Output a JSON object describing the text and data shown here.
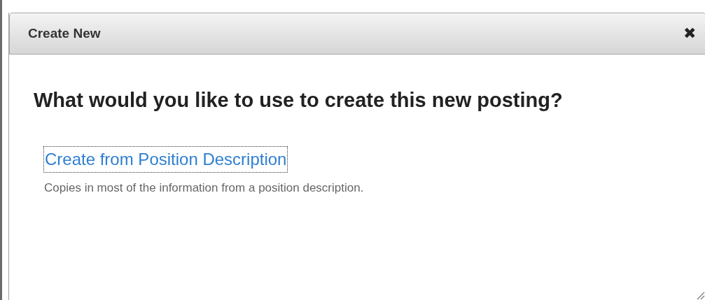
{
  "dialog": {
    "title": "Create New",
    "close": "✖",
    "heading": "What would you like to use to create this new posting?",
    "options": [
      {
        "label": "Create from Position Description",
        "focused": true,
        "description": "Copies in most of the information from a position description."
      }
    ]
  }
}
